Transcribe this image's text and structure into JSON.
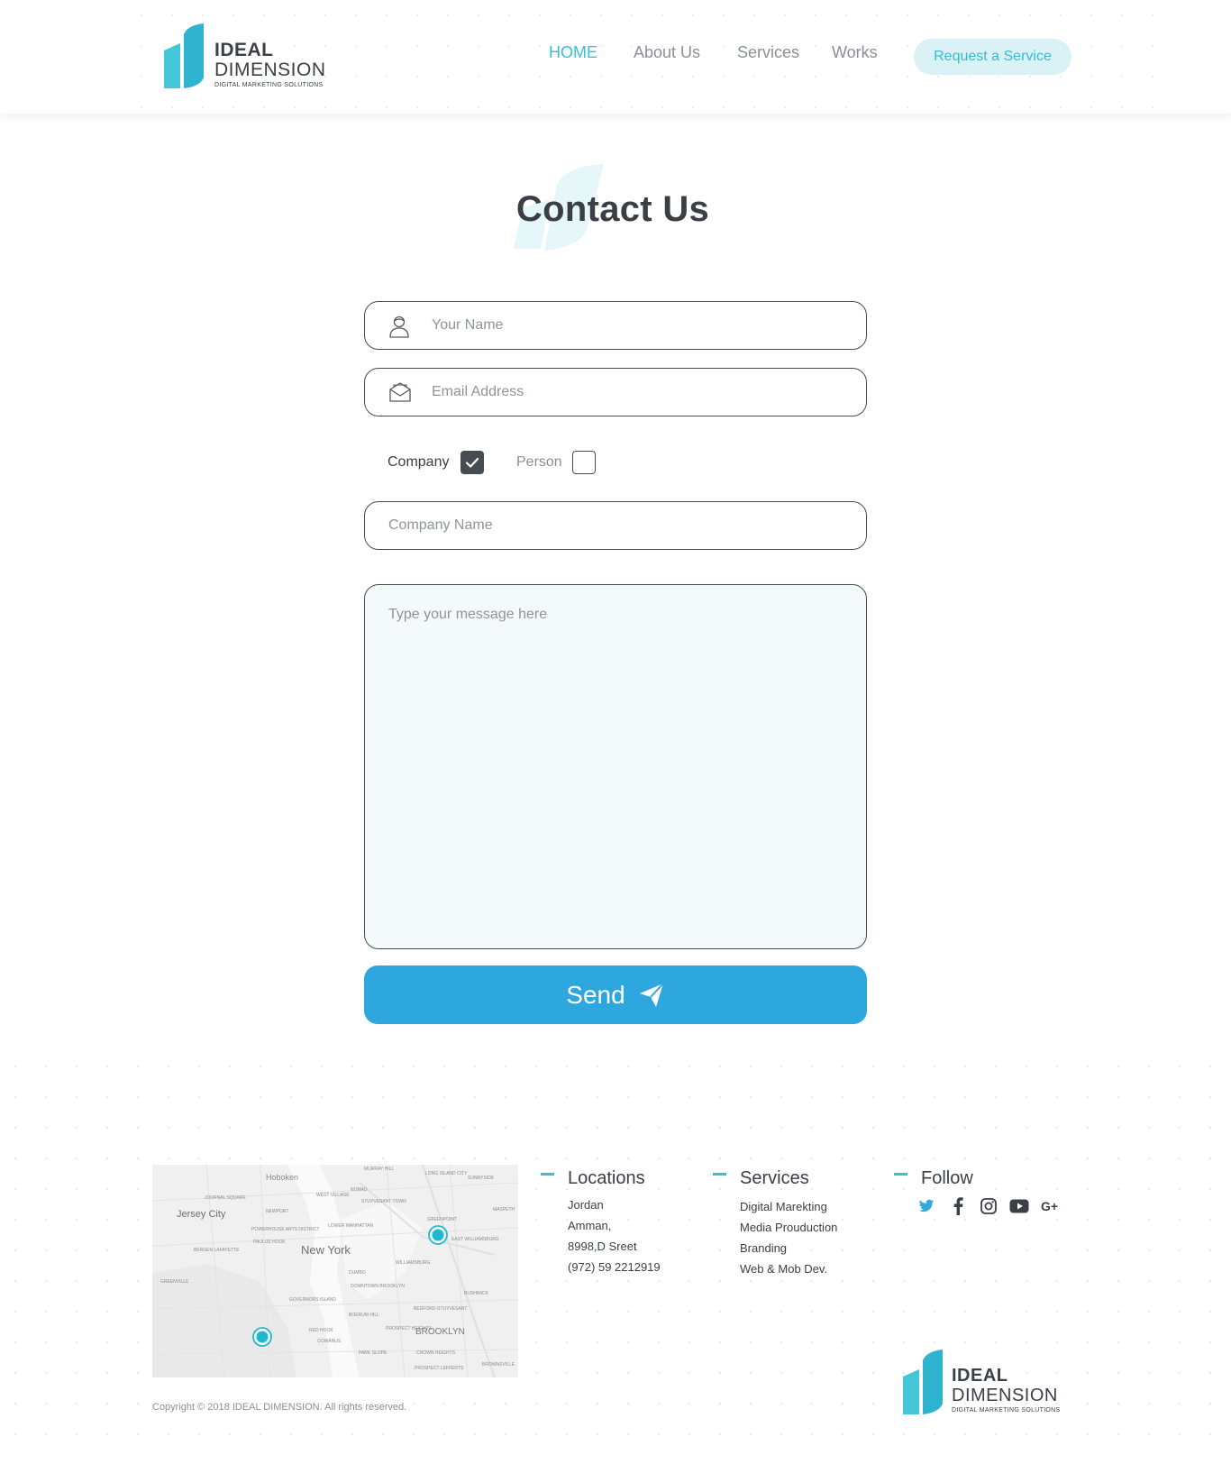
{
  "brand": {
    "name_line1": "IDEAL",
    "name_line2": "DIMENSION",
    "tagline": "DIGITAL MARKETING SOLUTIONS",
    "color_primary": "#34c0d6",
    "color_button": "#2ea7df",
    "color_text": "#3a3f45"
  },
  "nav": {
    "items": [
      {
        "label": "HOME",
        "active": true
      },
      {
        "label": "About Us",
        "active": false
      },
      {
        "label": "Services",
        "active": false
      },
      {
        "label": "Works",
        "active": false
      }
    ],
    "cta_label": "Request a Service"
  },
  "contact": {
    "title": "Contact Us",
    "name_placeholder": "Your Name",
    "email_placeholder": "Email Address",
    "options": [
      {
        "label": "Company",
        "checked": true
      },
      {
        "label": "Person",
        "checked": false
      }
    ],
    "company_placeholder": "Company Name",
    "message_placeholder": "Type your message here",
    "send_label": "Send"
  },
  "map": {
    "labels": [
      "Hoboken",
      "Jersey City",
      "New York",
      "BROOKLYN",
      "MURRAY HILL",
      "LONG ISLAND CITY",
      "SUNNYSIDE",
      "WEST VILLAGE",
      "NOMAD",
      "STUYVESANT TOWN",
      "JOURNAL SQUARE",
      "NEWPORT",
      "GREENPOINT",
      "MASPETH",
      "EAST WILLIAMSBURG",
      "POWERHOUSE ARTS DISTRICT",
      "PAULUS HOOK",
      "LOWER MANHATTAN",
      "BERGEN LAFAYETTE",
      "WILLIAMSBURG",
      "DUMBO",
      "DOWNTOWN BROOKLYN",
      "GREENVILLE",
      "GOVERNORS ISLAND",
      "BUSHWICK",
      "BEDFORD-STUYVESANT",
      "RED HOOK",
      "BOERUM HILL",
      "PROSPECT HEIGHTS",
      "GOWANUS",
      "PARK SLOPE",
      "CROWN HEIGHTS",
      "PROSPECT LEFFERTS",
      "BROWNSVILLE"
    ]
  },
  "footer": {
    "locations": {
      "heading": "Locations",
      "lines": [
        "Jordan",
        "Amman,",
        "8998,D Sreet",
        "(972) 59 2212919"
      ]
    },
    "services": {
      "heading": "Services",
      "lines": [
        "Digital Marekting",
        "Media Prouدction",
        "Branding",
        "Web & Mob Dev."
      ]
    },
    "follow": {
      "heading": "Follow",
      "icons": [
        "twitter-icon",
        "facebook-icon",
        "instagram-icon",
        "youtube-icon",
        "google-plus-icon"
      ]
    },
    "copyright": "Copyright © 2018 IDEAL DIMENSION.  All rights reserved."
  }
}
